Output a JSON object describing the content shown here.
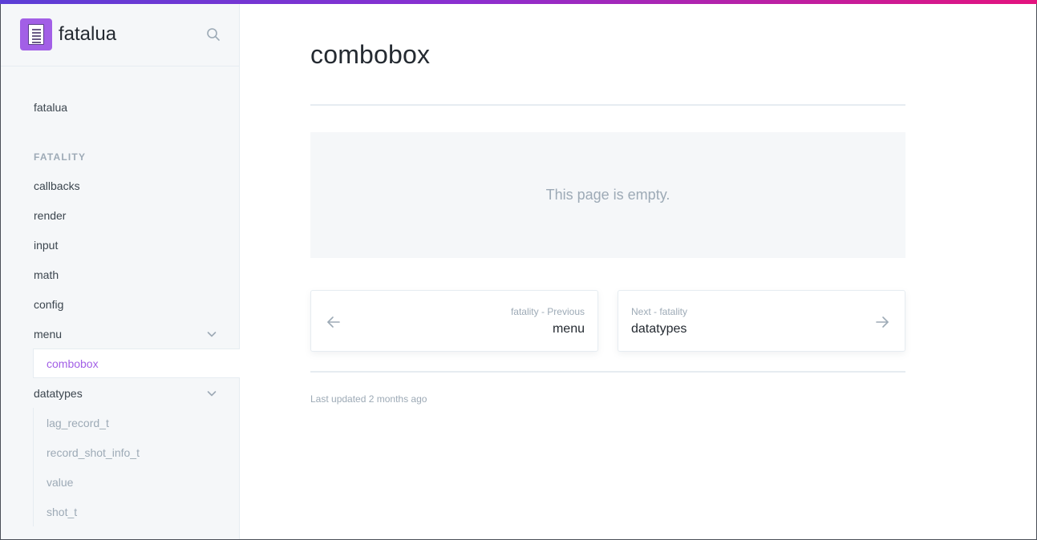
{
  "brand": {
    "name": "fatalua",
    "logo_icon": "document-icon"
  },
  "sidebar": {
    "top_item": "fatalua",
    "group_title": "FATALITY",
    "items": [
      {
        "label": "callbacks"
      },
      {
        "label": "render"
      },
      {
        "label": "input"
      },
      {
        "label": "math"
      },
      {
        "label": "config"
      },
      {
        "label": "menu",
        "expanded": true
      }
    ],
    "active_item": "combobox",
    "datatypes": {
      "label": "datatypes",
      "expanded": true,
      "children": [
        "lag_record_t",
        "record_shot_info_t",
        "value",
        "shot_t"
      ]
    }
  },
  "main": {
    "title": "combobox",
    "empty_message": "This page is empty.",
    "previous": {
      "hint": "fatality - Previous",
      "label": "menu"
    },
    "next": {
      "hint": "Next - fatality",
      "label": "datatypes"
    },
    "last_updated": "Last updated 2 months ago"
  },
  "colors": {
    "accent": "#a25fe6",
    "text": "#242a31",
    "muted": "#9daab6",
    "sidebar_bg": "#f5f7f9",
    "border": "#e6ecf1"
  }
}
